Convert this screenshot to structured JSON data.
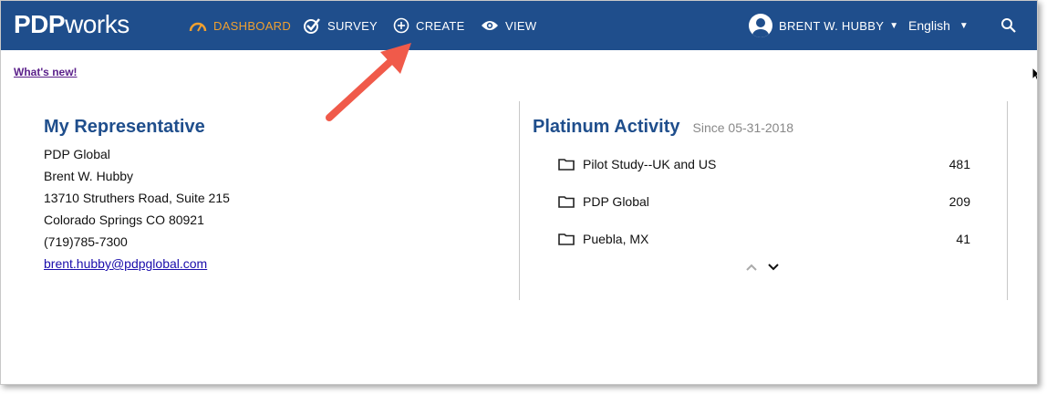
{
  "header": {
    "logo_bold": "PDP",
    "logo_light": "works",
    "nav": [
      {
        "label": "DASHBOARD",
        "icon": "speedometer-icon",
        "active": true
      },
      {
        "label": "SURVEY",
        "icon": "checkbox-icon"
      },
      {
        "label": "CREATE",
        "icon": "plus-circle-icon"
      },
      {
        "label": "VIEW",
        "icon": "eye-icon"
      }
    ],
    "user_name": "BRENT W. HUBBY",
    "language": "English"
  },
  "whats_new": "What's new!",
  "representative": {
    "title": "My Representative",
    "company": "PDP Global",
    "name": "Brent W. Hubby",
    "street": "13710 Struthers Road, Suite 215",
    "city_line": "Colorado Springs CO 80921",
    "phone": "(719)785-7300",
    "email": "brent.hubby@pdpglobal.com"
  },
  "activity": {
    "title": "Platinum Activity",
    "since": "Since 05-31-2018",
    "items": [
      {
        "name": "Pilot Study--UK and US",
        "count": "481"
      },
      {
        "name": "PDP Global",
        "count": "209"
      },
      {
        "name": "Puebla, MX",
        "count": "41"
      }
    ]
  },
  "colors": {
    "header_bg": "#1f4e8c",
    "active_nav": "#f0a030",
    "title_blue": "#1f4e8c",
    "annotation_arrow": "#f05a4a"
  }
}
